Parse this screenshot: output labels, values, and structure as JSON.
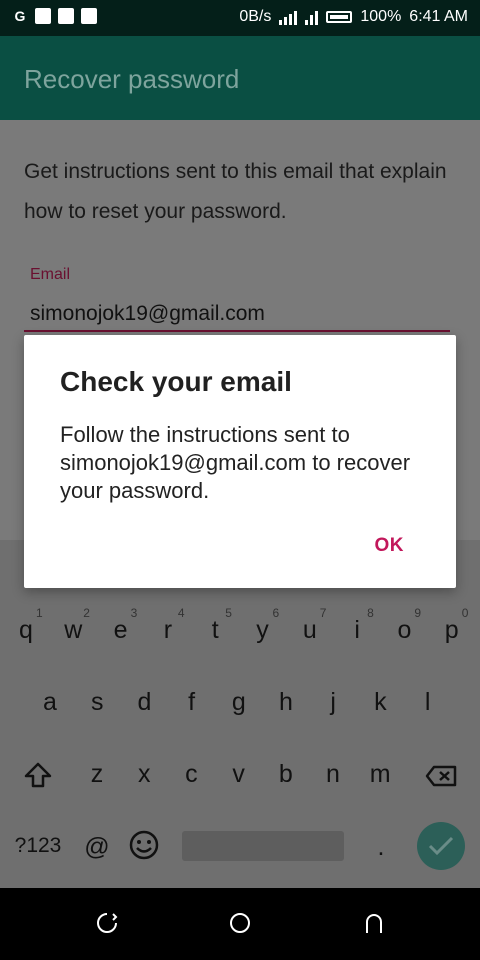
{
  "status_bar": {
    "net_speed": "0B/s",
    "battery": "100%",
    "time": "6:41 AM"
  },
  "app_bar": {
    "title": "Recover password"
  },
  "main": {
    "description": "Get instructions sent to this email that explain how to reset your password.",
    "email_label": "Email",
    "email_value": "simonojok19@gmail.com"
  },
  "dialog": {
    "title": "Check your email",
    "body": "Follow the instructions sent to simonojok19@gmail.com to recover your password.",
    "ok_label": "OK"
  },
  "keyboard": {
    "row1": [
      "q",
      "w",
      "e",
      "r",
      "t",
      "y",
      "u",
      "i",
      "o",
      "p"
    ],
    "row1_numbers": [
      "1",
      "2",
      "3",
      "4",
      "5",
      "6",
      "7",
      "8",
      "9",
      "0"
    ],
    "row2": [
      "a",
      "s",
      "d",
      "f",
      "g",
      "h",
      "j",
      "k",
      "l"
    ],
    "row3": [
      "z",
      "x",
      "c",
      "v",
      "b",
      "n",
      "m"
    ],
    "symbols_label": "?123",
    "at_label": "@",
    "period_label": "."
  }
}
